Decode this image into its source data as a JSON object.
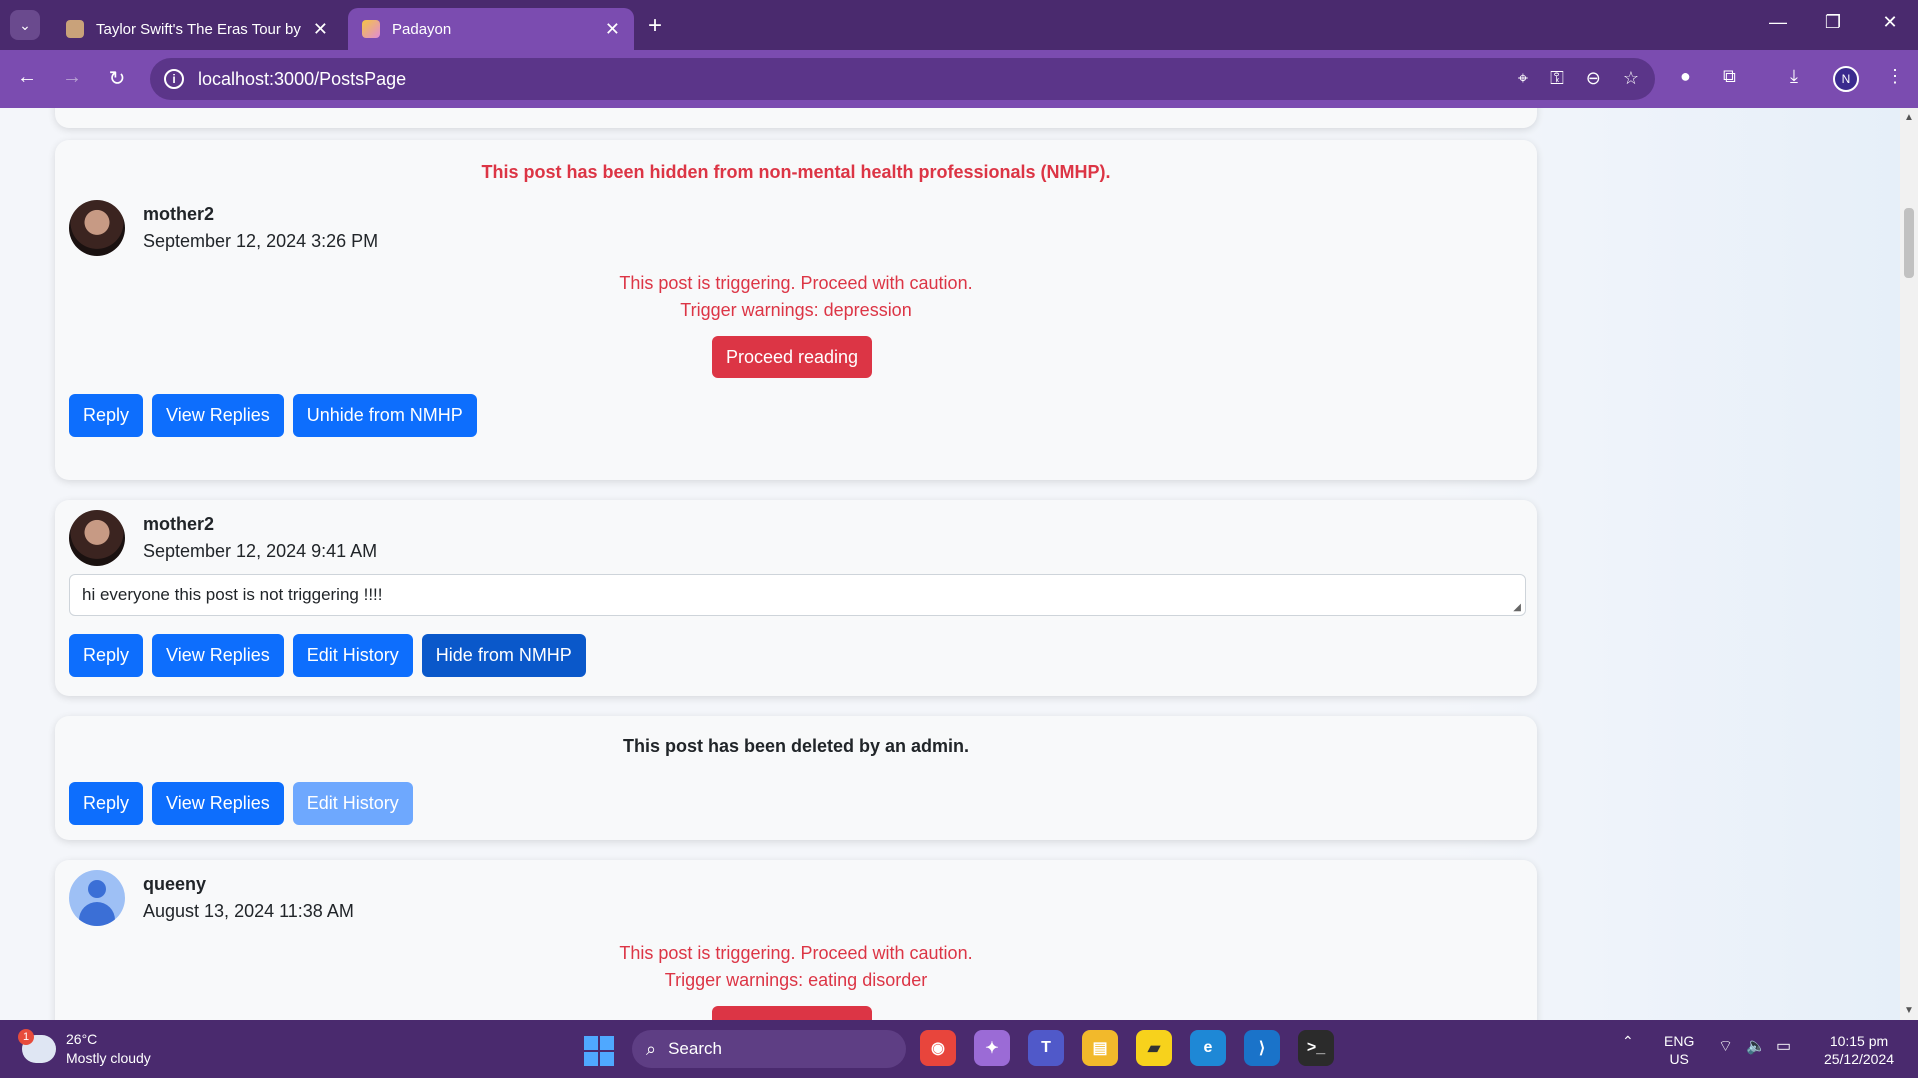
{
  "browser": {
    "tabs": [
      {
        "title": "Taylor Swift's The Eras Tour by N"
      },
      {
        "title": "Padayon"
      }
    ],
    "url": "localhost:3000/PostsPage",
    "profile_initial": "N"
  },
  "posts": [
    {
      "hidden_note": "This post has been hidden from non-mental health professionals (NMHP).",
      "author": "mother2",
      "date": "September 12, 2024 3:26 PM",
      "warning_line1": "This post is triggering. Proceed with caution.",
      "warning_line2": "Trigger warnings: depression",
      "proceed_label": "Proceed reading",
      "actions": [
        "Reply",
        "View Replies",
        "Unhide from NMHP"
      ]
    },
    {
      "author": "mother2",
      "date": "September 12, 2024 9:41 AM",
      "text": "hi everyone this post is not triggering !!!!",
      "actions": [
        "Reply",
        "View Replies",
        "Edit History",
        "Hide from NMHP"
      ]
    },
    {
      "deleted_note": "This post has been deleted by an admin.",
      "actions": [
        "Reply",
        "View Replies",
        "Edit History"
      ]
    },
    {
      "author": "queeny",
      "date": "August 13, 2024 11:38 AM",
      "warning_line1": "This post is triggering. Proceed with caution.",
      "warning_line2": "Trigger warnings: eating disorder"
    }
  ],
  "taskbar": {
    "weather_temp": "26°C",
    "weather_desc": "Mostly cloudy",
    "weather_badge": "1",
    "search_label": "Search",
    "lang1": "ENG",
    "lang2": "US",
    "time": "10:15 pm",
    "date": "25/12/2024"
  },
  "colors": {
    "accent": "#0d6efd",
    "danger": "#dc3545",
    "browser": "#7b4cb0"
  }
}
